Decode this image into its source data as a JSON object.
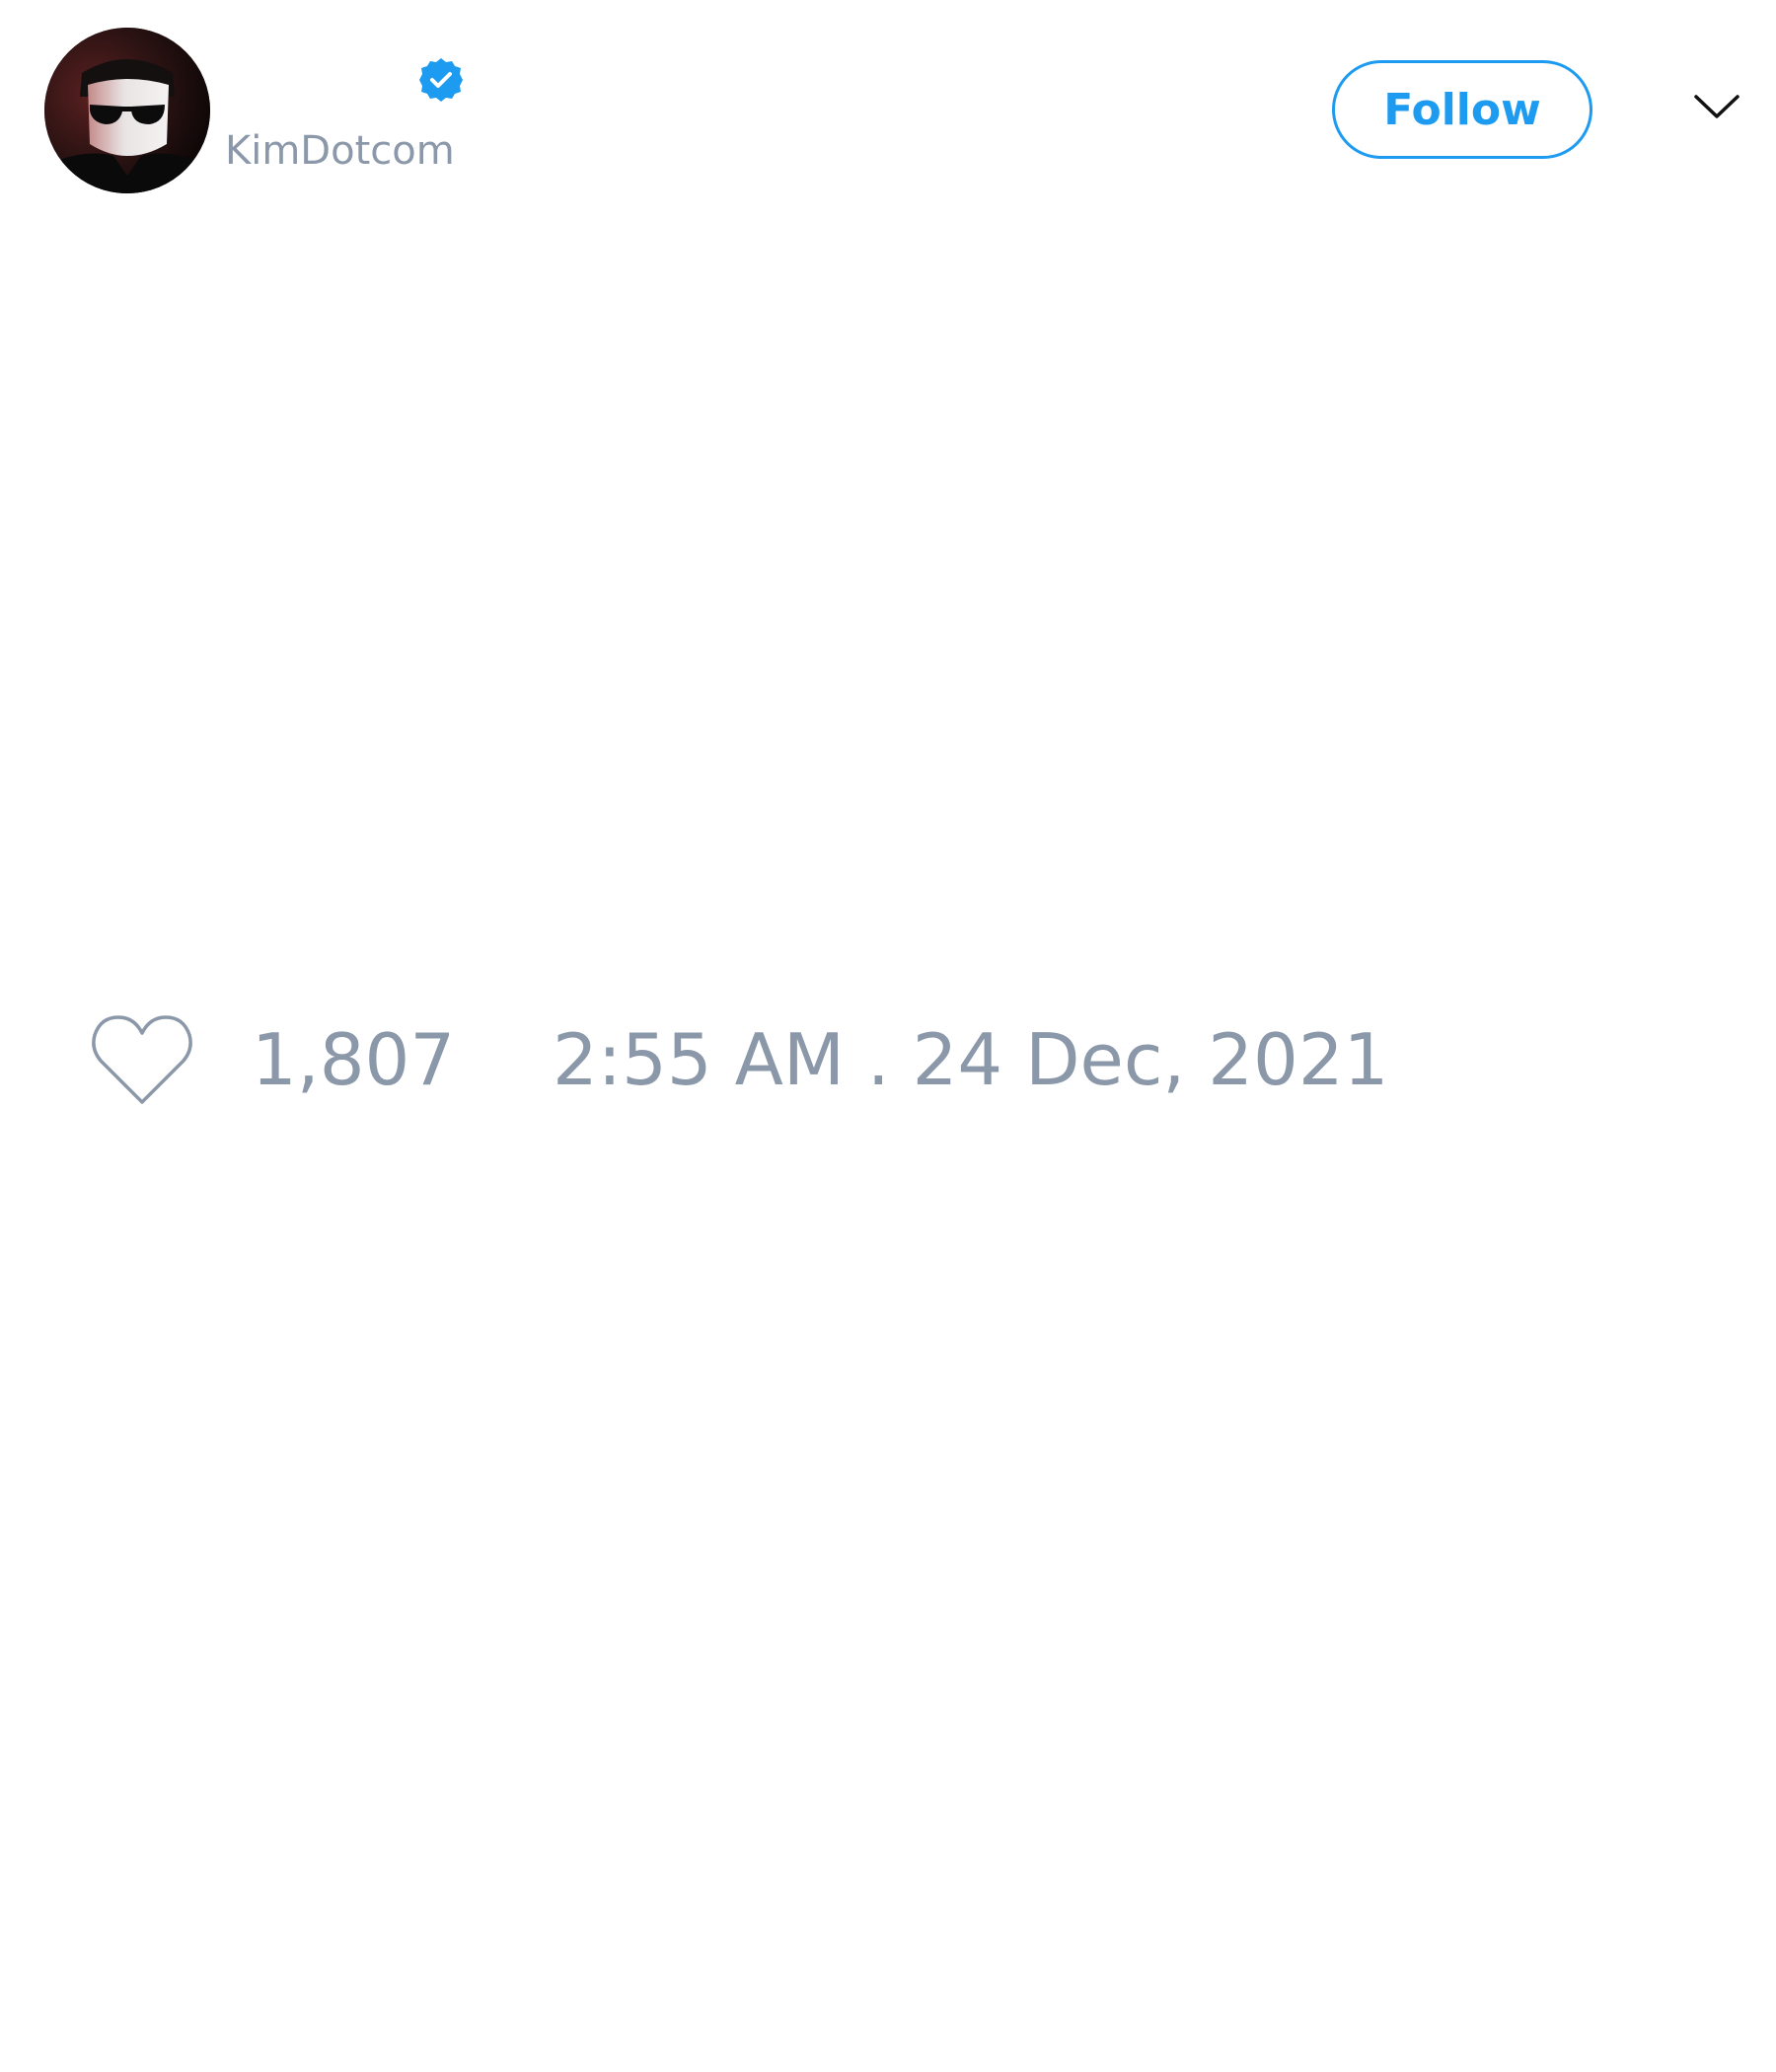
{
  "author": {
    "handle": "KimDotcom",
    "verified": true,
    "avatar_icon": "profile-photo"
  },
  "actions": {
    "follow_label": "Follow",
    "menu_icon": "chevron-down-icon"
  },
  "stats": {
    "like_icon": "heart-outline-icon",
    "like_count": "1,807",
    "timestamp": "2:55 AM . 24 Dec, 2021"
  },
  "colors": {
    "accent": "#1d9bf0",
    "muted_text": "#8b98a9",
    "icon_stroke": "#8b98a9",
    "background": "#ffffff"
  }
}
